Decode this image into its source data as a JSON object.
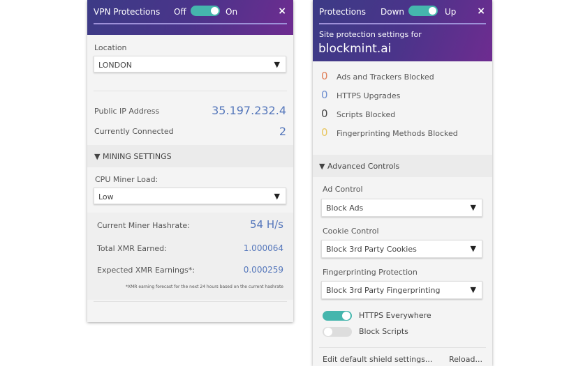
{
  "vpn": {
    "title": "VPN Protections",
    "off": "Off",
    "on": "On",
    "close": "×",
    "location_label": "Location",
    "location": "LONDON",
    "ip_label": "Public IP Address",
    "ip": "35.197.232.4",
    "connected_label": "Currently Connected",
    "connected": "2",
    "mining_header": "▼ MINING SETTINGS",
    "cpu_label": "CPU Miner Load:",
    "cpu": "Low",
    "hashrate_label": "Current Miner Hashrate:",
    "hashrate": "54 H/s",
    "earned_label": "Total XMR Earned:",
    "earned": "1.000064",
    "expected_label": "Expected XMR Earnings*:",
    "expected": "0.000259",
    "footnote": "*XMR earning forecast for the next 24 hours based on the current hashrate"
  },
  "shields": {
    "title": "Protections",
    "down": "Down",
    "up": "Up",
    "close": "×",
    "subtitle": "Site protection settings for",
    "site": "blockmint.ai",
    "stats": [
      {
        "n": "0",
        "label": "Ads and Trackers Blocked",
        "color": "#e0805a"
      },
      {
        "n": "0",
        "label": "HTTPS Upgrades",
        "color": "#6f8fd0"
      },
      {
        "n": "0",
        "label": "Scripts Blocked",
        "color": "#444444"
      },
      {
        "n": "0",
        "label": "Fingerprinting Methods Blocked",
        "color": "#e8c660"
      }
    ],
    "advanced": "▼ Advanced Controls",
    "ad_label": "Ad Control",
    "ad": "Block Ads",
    "cookie_label": "Cookie Control",
    "cookie": "Block 3rd Party Cookies",
    "fp_label": "Fingerprinting Protection",
    "fp": "Block 3rd Party Fingerprinting",
    "https": "HTTPS Everywhere",
    "scripts": "Block Scripts",
    "edit": "Edit default shield settings...",
    "reload": "Reload..."
  },
  "arrow": "▼"
}
